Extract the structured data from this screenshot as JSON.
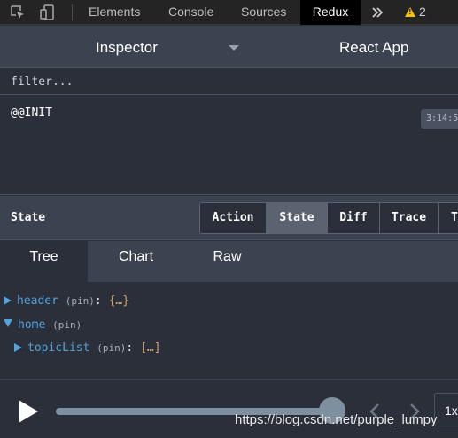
{
  "devtools": {
    "tabs": [
      "Elements",
      "Console",
      "Sources",
      "Redux"
    ],
    "active_tab": "Redux",
    "overflow_icon": "double-chevron-right-icon",
    "warning_count": "2"
  },
  "inspector": {
    "monitor_label": "Inspector",
    "app_name": "React App"
  },
  "filter": {
    "placeholder": "filter...",
    "value": ""
  },
  "actions": [
    {
      "name": "@@INIT",
      "time": "3:14:5"
    }
  ],
  "state_panel": {
    "title": "State",
    "view_tabs": [
      "Action",
      "State",
      "Diff",
      "Trace",
      "T"
    ],
    "active_view_tab": "State",
    "sub_tabs": [
      "Tree",
      "Chart",
      "Raw"
    ],
    "active_sub_tab": "Tree"
  },
  "tree": [
    {
      "key": "header",
      "pin": "(pin)",
      "colon": ":",
      "value": "{…}",
      "expanded": false
    },
    {
      "key": "home",
      "pin": "(pin)",
      "colon": "",
      "value": "",
      "expanded": true
    },
    {
      "key": "topicList",
      "pin": "(pin)",
      "colon": ":",
      "value": "[…]",
      "expanded": false
    }
  ],
  "slider": {
    "play_icon": "play-icon",
    "position_fraction": 1.0,
    "speed_label": "1x"
  },
  "watermark": "https://blog.csdn.net/purple_lumpy",
  "colors": {
    "key": "#55a2d9",
    "value": "#d6a26a",
    "panel": "#3b4250",
    "background": "#2a2f3a",
    "warning": "#f3c10b"
  }
}
